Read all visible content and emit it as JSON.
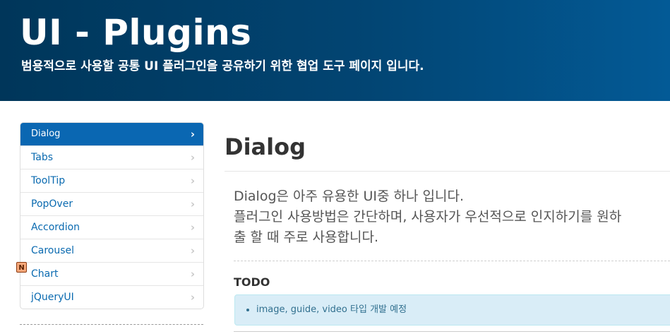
{
  "header": {
    "title": "UI - Plugins",
    "subtitle": "범용적으로 사용할 공통 UI 플러그인을 공유하기 위한 협업 도구 페이지 입니다."
  },
  "sidebar": {
    "items": [
      {
        "label": "Dialog",
        "active": true
      },
      {
        "label": "Tabs"
      },
      {
        "label": "ToolTip"
      },
      {
        "label": "PopOver"
      },
      {
        "label": "Accordion"
      },
      {
        "label": "Carousel"
      },
      {
        "label": "Chart"
      },
      {
        "label": "jQueryUI"
      }
    ],
    "chevron": "›",
    "new_badge": "N"
  },
  "main": {
    "title": "Dialog",
    "description": [
      "Dialog은 아주 유용한 UI중 하나 입니다.",
      "플러그인 사용방법은 간단하며, 사용자가 우선적으로 인지하기를 원하",
      "출 할 때 주로 사용합니다."
    ],
    "todo_heading": "TODO",
    "todo_items": [
      "image, guide, video 타입 개발 예정"
    ]
  },
  "colors": {
    "header_dark": "#00365a",
    "header_light": "#035a96",
    "accent": "#0a67b2",
    "alert_bg": "#d9edf7",
    "alert_text": "#31708f",
    "badge": "#f5a87b"
  }
}
